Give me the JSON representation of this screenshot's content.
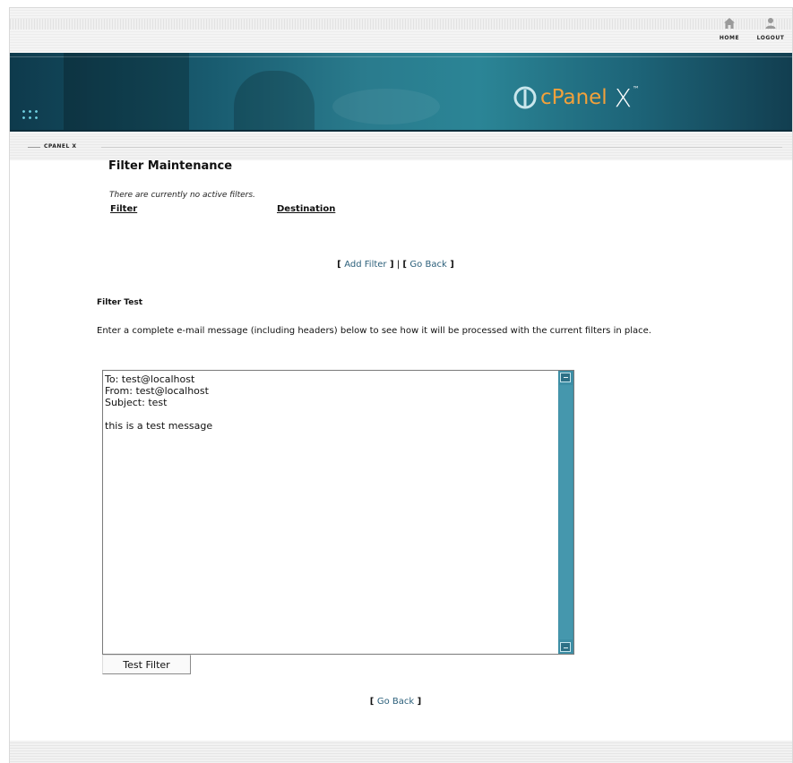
{
  "header": {
    "nav": {
      "home_label": "HOME",
      "home_icon": "home-icon",
      "logout_label": "LOGOUT",
      "logout_icon": "user-icon"
    },
    "logo": {
      "text": "cPanel",
      "suffix": "X",
      "trademark": "™",
      "text_color": "#f2a13b"
    },
    "breadcrumb": "CPANEL X"
  },
  "filters": {
    "title": "Filter Maintenance",
    "empty_message": "There are currently no active filters.",
    "columns": [
      "Filter",
      "Destination"
    ],
    "add_filter_label": "Add Filter",
    "go_back_label": "Go Back",
    "separator": "|"
  },
  "filter_test": {
    "heading": "Filter Test",
    "description": "Enter a complete e-mail message (including headers) below to see how it will be processed with the current filters in place.",
    "message": "To: test@localhost\nFrom: test@localhost\nSubject: test\n\nthis is a test message",
    "button_label": "Test Filter",
    "go_back_label": "Go Back"
  },
  "colors": {
    "banner": "#1d6478",
    "link": "#2b5f7a",
    "scrollbar": "#3d8ea5"
  }
}
